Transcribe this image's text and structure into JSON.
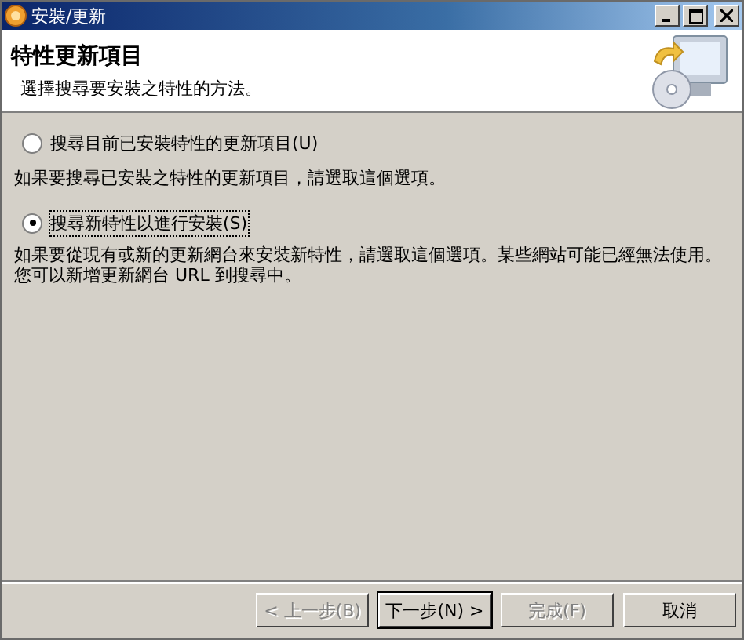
{
  "window": {
    "title": "安裝/更新"
  },
  "header": {
    "title": "特性更新項目",
    "subtitle": "選擇搜尋要安裝之特性的方法。"
  },
  "options": [
    {
      "label": "搜尋目前已安裝特性的更新項目(U)",
      "description": "如果要搜尋已安裝之特性的更新項目，請選取這個選項。",
      "selected": false
    },
    {
      "label": "搜尋新特性以進行安裝(S)",
      "description": "如果要從現有或新的更新網台來安裝新特性，請選取這個選項。某些網站可能已經無法使用。您可以新增更新網台 URL 到搜尋中。",
      "selected": true
    }
  ],
  "buttons": [
    {
      "label": "< 上一步(B)",
      "disabled": true,
      "default": false
    },
    {
      "label": "下一步(N) >",
      "disabled": false,
      "default": true
    },
    {
      "label": "完成(F)",
      "disabled": true,
      "default": false
    },
    {
      "label": "取消",
      "disabled": false,
      "default": false
    }
  ]
}
